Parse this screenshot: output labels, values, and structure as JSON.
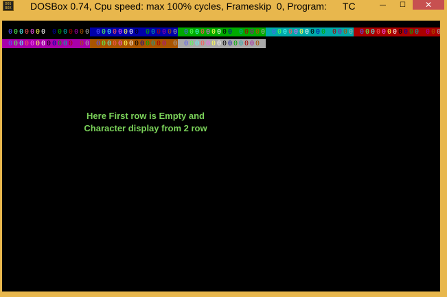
{
  "window": {
    "title": "DOSBox 0.74, Cpu speed: max 100% cycles, Frameskip  0, Program:      TC",
    "icon_name": "dosbox-icon",
    "icon_text": "DOS BOX",
    "controls": {
      "minimize": "—",
      "maximize": "☐",
      "close": "✕"
    }
  },
  "screen": {
    "char_glyph": "0",
    "palette": [
      "#000000",
      "#0000aa",
      "#00aa00",
      "#00aaaa",
      "#aa0000",
      "#aa00aa",
      "#aa5500",
      "#aaaaaa"
    ],
    "foregrounds": [
      "#555555",
      "#5555ff",
      "#55ff55",
      "#55ffff",
      "#ff5555",
      "#ff55ff",
      "#ffff55",
      "#ffffff",
      "#000000",
      "#0000aa",
      "#00aa00",
      "#00aaaa",
      "#aa0000",
      "#aa00aa",
      "#aa5500",
      "#aaaaaa"
    ],
    "message_line1": "Here First row is Empty and",
    "message_line2": "Character display from 2 row"
  }
}
